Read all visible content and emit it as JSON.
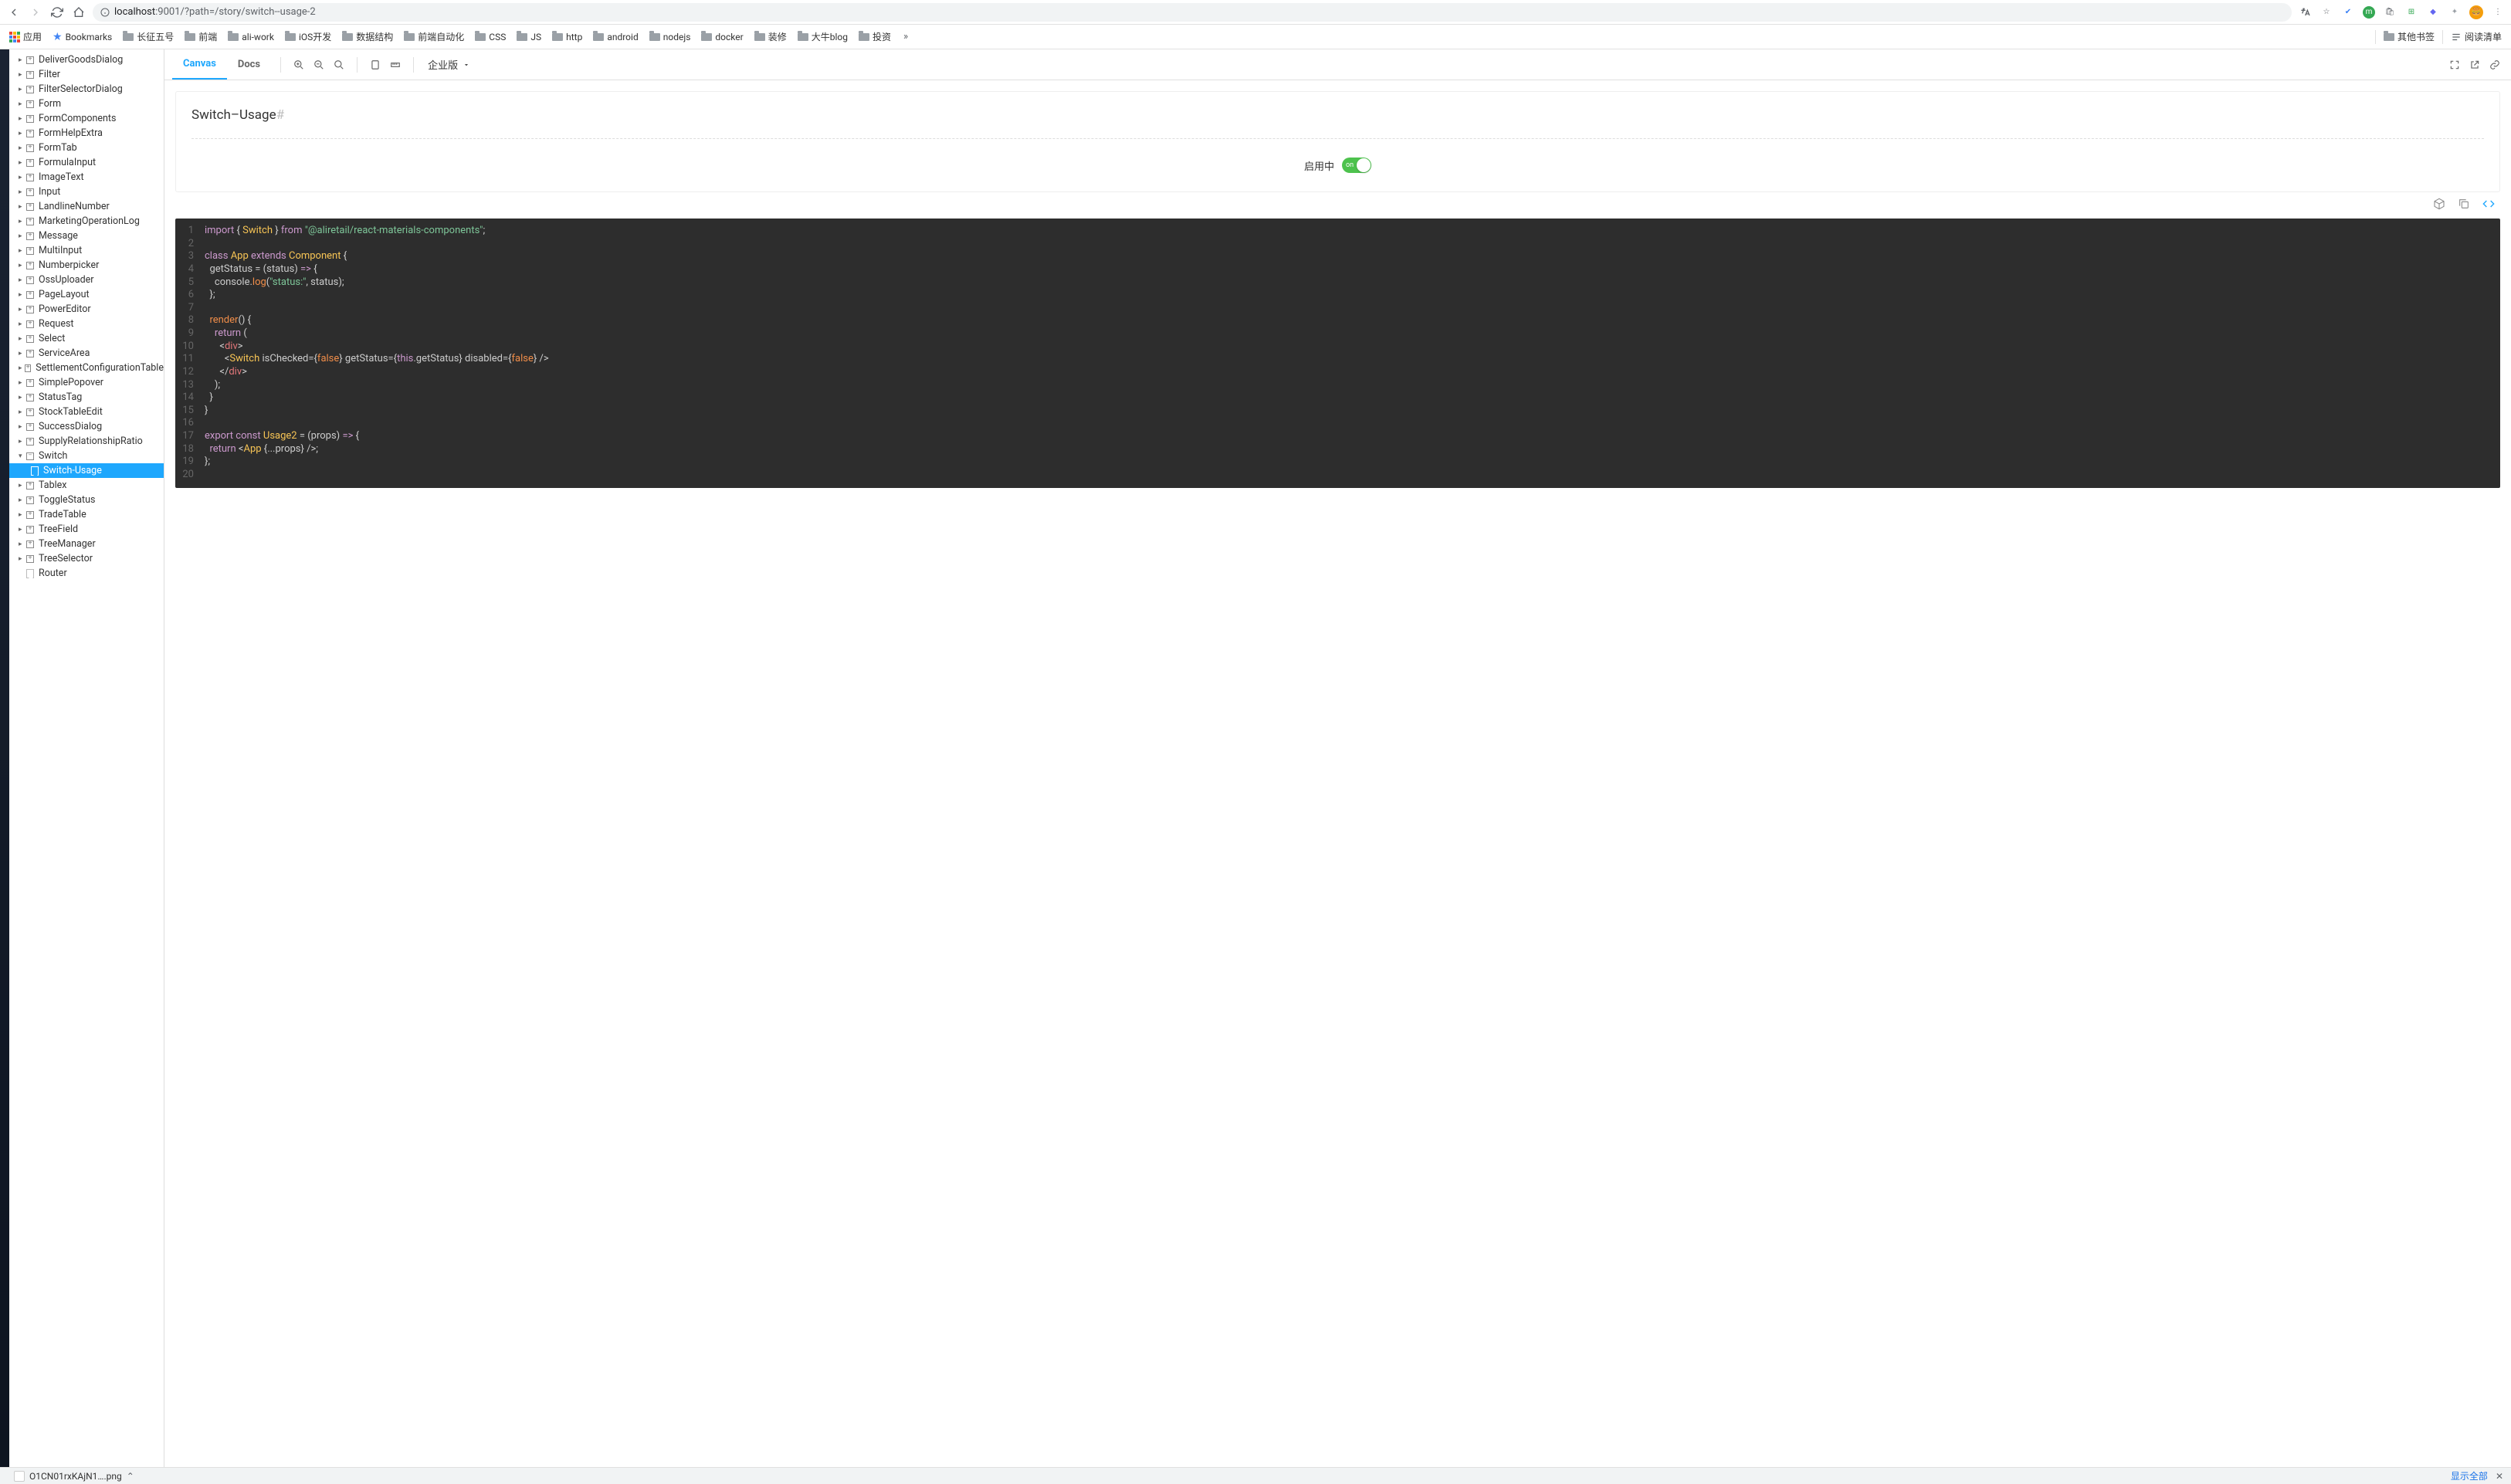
{
  "browser": {
    "url_host": "localhost",
    "url_port": ":9001",
    "url_path": "/?path=/story/switch--usage-2",
    "translate_icon": "translate",
    "star_icon": "star"
  },
  "bookmarks": {
    "apps": "应用",
    "bookmarks_link": "Bookmarks",
    "folders": [
      "长征五号",
      "前端",
      "ali-work",
      "iOS开发",
      "数据结构",
      "前端自动化",
      "CSS",
      "JS",
      "http",
      "android",
      "nodejs",
      "docker",
      "装修",
      "大牛blog",
      "投资"
    ],
    "other_bookmarks": "其他书签",
    "reading_list": "阅读清单"
  },
  "sidebar": {
    "items": [
      {
        "label": "DeliverGoodsDialog"
      },
      {
        "label": "Filter"
      },
      {
        "label": "FilterSelectorDialog"
      },
      {
        "label": "Form"
      },
      {
        "label": "FormComponents"
      },
      {
        "label": "FormHelpExtra"
      },
      {
        "label": "FormTab"
      },
      {
        "label": "FormulaInput"
      },
      {
        "label": "ImageText"
      },
      {
        "label": "Input"
      },
      {
        "label": "LandlineNumber"
      },
      {
        "label": "MarketingOperationLog"
      },
      {
        "label": "Message"
      },
      {
        "label": "MultiInput"
      },
      {
        "label": "Numberpicker"
      },
      {
        "label": "OssUploader"
      },
      {
        "label": "PageLayout"
      },
      {
        "label": "PowerEditor"
      },
      {
        "label": "Request"
      },
      {
        "label": "Select"
      },
      {
        "label": "ServiceArea"
      },
      {
        "label": "SettlementConfigurationTable"
      },
      {
        "label": "SimplePopover"
      },
      {
        "label": "StatusTag"
      },
      {
        "label": "StockTableEdit"
      },
      {
        "label": "SuccessDialog"
      },
      {
        "label": "SupplyRelationshipRatio"
      },
      {
        "label": "Switch",
        "open": true,
        "children": [
          {
            "label": "Switch-Usage",
            "selected": true
          }
        ]
      },
      {
        "label": "Tablex"
      },
      {
        "label": "ToggleStatus"
      },
      {
        "label": "TradeTable"
      },
      {
        "label": "TreeField"
      },
      {
        "label": "TreeManager"
      },
      {
        "label": "TreeSelector"
      },
      {
        "label": "Router",
        "leaf": true
      }
    ]
  },
  "topbar": {
    "tabs": {
      "canvas": "Canvas",
      "docs": "Docs"
    },
    "version_dropdown": "企业版"
  },
  "preview": {
    "title": "Switch–Usage",
    "hash": "#",
    "switch_label": "启用中",
    "switch_state_text": "on"
  },
  "code": {
    "lines": [
      {
        "n": 1,
        "html": "<span class='tok-kw'>import</span> { <span class='tok-cls'>Switch</span> } <span class='tok-kw'>from</span> <span class='tok-str'>\"@aliretail/react-materials-components\"</span>;"
      },
      {
        "n": 2,
        "html": ""
      },
      {
        "n": 3,
        "html": "<span class='tok-kw'>class</span> <span class='tok-cls'>App</span> <span class='tok-kw'>extends</span> <span class='tok-cls'>Component</span> {"
      },
      {
        "n": 4,
        "html": "  getStatus = (<span class='tok-param'>status</span>) <span class='tok-kw'>=&gt;</span> {"
      },
      {
        "n": 5,
        "html": "    <span class='tok-ident'>console</span>.<span class='tok-fn'>log</span>(<span class='tok-str'>\"status:\"</span>, status);"
      },
      {
        "n": 6,
        "html": "  };"
      },
      {
        "n": 7,
        "html": ""
      },
      {
        "n": 8,
        "html": "  <span class='tok-fn'>render</span>() {"
      },
      {
        "n": 9,
        "html": "    <span class='tok-kw'>return</span> ("
      },
      {
        "n": 10,
        "html": "      &lt;<span class='tok-tag'>div</span>&gt;"
      },
      {
        "n": 11,
        "html": "        &lt;<span class='tok-cls'>Switch</span> isChecked={<span class='tok-const'>false</span>} getStatus={<span class='tok-this'>this</span>.getStatus} disabled={<span class='tok-const'>false</span>} /&gt;"
      },
      {
        "n": 12,
        "html": "      &lt;/<span class='tok-tag'>div</span>&gt;"
      },
      {
        "n": 13,
        "html": "    );"
      },
      {
        "n": 14,
        "html": "  }"
      },
      {
        "n": 15,
        "html": "}"
      },
      {
        "n": 16,
        "html": ""
      },
      {
        "n": 17,
        "html": "<span class='tok-kw'>export</span> <span class='tok-kw'>const</span> <span class='tok-cls'>Usage2</span> = (<span class='tok-param'>props</span>) <span class='tok-kw'>=&gt;</span> {"
      },
      {
        "n": 18,
        "html": "  <span class='tok-kw'>return</span> &lt;<span class='tok-cls'>App</span> {...props} /&gt;;"
      },
      {
        "n": 19,
        "html": "};"
      },
      {
        "n": 20,
        "html": ""
      }
    ]
  },
  "download_bar": {
    "filename": "O1CN01rxKAjN1….png",
    "show_all": "显示全部"
  }
}
